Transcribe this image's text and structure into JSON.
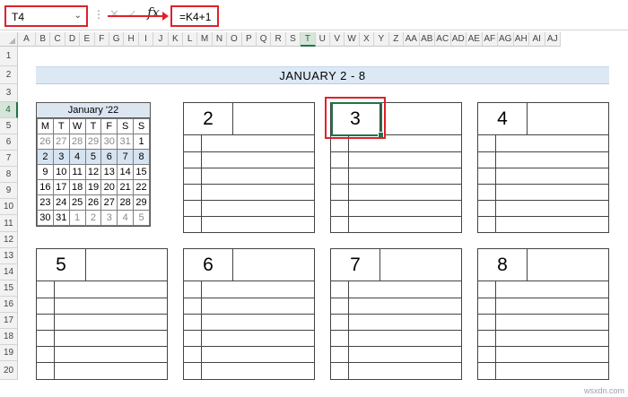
{
  "formula_bar": {
    "name_box": "T4",
    "dots": "⋮",
    "cancel": "✕",
    "enter": "✓",
    "fx": "fx",
    "formula": "=K4+1"
  },
  "columns": [
    "A",
    "B",
    "C",
    "D",
    "E",
    "F",
    "G",
    "H",
    "I",
    "J",
    "K",
    "L",
    "M",
    "N",
    "O",
    "P",
    "Q",
    "R",
    "S",
    "T",
    "U",
    "V",
    "W",
    "X",
    "Y",
    "Z",
    "AA",
    "AB",
    "AC",
    "AD",
    "AE",
    "AF",
    "AG",
    "AH",
    "AI",
    "AJ"
  ],
  "rows": [
    "1",
    "2",
    "3",
    "4",
    "5",
    "6",
    "7",
    "8",
    "9",
    "10",
    "11",
    "12",
    "13",
    "14",
    "15",
    "16",
    "17",
    "18",
    "19",
    "20"
  ],
  "selected_column": "T",
  "selected_row": "4",
  "title": "JANUARY  2 - 8",
  "mini_calendar": {
    "title": "January '22",
    "weekday_headers": [
      "M",
      "T",
      "W",
      "T",
      "F",
      "S",
      "S"
    ],
    "weeks": [
      [
        "26",
        "27",
        "28",
        "29",
        "30",
        "31",
        "1"
      ],
      [
        "2",
        "3",
        "4",
        "5",
        "6",
        "7",
        "8"
      ],
      [
        "9",
        "10",
        "11",
        "12",
        "13",
        "14",
        "15"
      ],
      [
        "16",
        "17",
        "18",
        "19",
        "20",
        "21",
        "22"
      ],
      [
        "23",
        "24",
        "25",
        "26",
        "27",
        "28",
        "29"
      ],
      [
        "30",
        "31",
        "1",
        "2",
        "3",
        "4",
        "5"
      ]
    ]
  },
  "days": [
    "2",
    "3",
    "4",
    "5",
    "6",
    "7",
    "8"
  ],
  "watermark": "wsxdn.com"
}
